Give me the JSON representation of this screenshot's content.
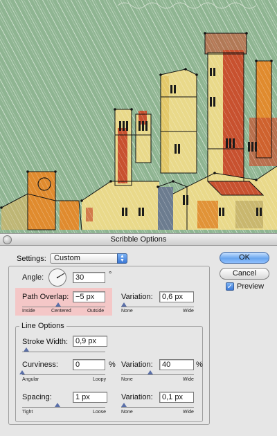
{
  "dialog": {
    "title": "Scribble Options",
    "settings_label": "Settings:",
    "settings_value": "Custom",
    "angle_label": "Angle:",
    "angle_value": "30",
    "angle_unit": "°",
    "path_overlap_label": "Path Overlap:",
    "path_overlap_value": "−5 px",
    "path_overlap_slider": {
      "min_label": "Inside",
      "mid_label": "Centered",
      "max_label": "Outside"
    },
    "path_overlap_variation_label": "Variation:",
    "path_overlap_variation_value": "0,6 px",
    "path_overlap_variation_slider": {
      "min_label": "None",
      "max_label": "Wide"
    },
    "line_options_title": "Line Options",
    "stroke_width_label": "Stroke Width:",
    "stroke_width_value": "0,9 px",
    "curviness_label": "Curviness:",
    "curviness_value": "0",
    "curviness_unit": "%",
    "curviness_slider": {
      "min_label": "Angular",
      "max_label": "Loopy"
    },
    "curviness_variation_label": "Variation:",
    "curviness_variation_value": "40",
    "curviness_variation_unit": "%",
    "curviness_variation_slider": {
      "min_label": "None",
      "max_label": "Wide"
    },
    "spacing_label": "Spacing:",
    "spacing_value": "1 px",
    "spacing_slider": {
      "min_label": "Tight",
      "max_label": "Loose"
    },
    "spacing_variation_label": "Variation:",
    "spacing_variation_value": "0,1 px",
    "spacing_variation_slider": {
      "min_label": "None",
      "max_label": "Wide"
    },
    "ok_label": "OK",
    "cancel_label": "Cancel",
    "preview_label": "Preview",
    "preview_checked": true
  },
  "colors": {
    "background_green": "#8fb592",
    "roof_red": "#c8512f",
    "wall_orange": "#e08b2e",
    "wall_yellow": "#e9d98a",
    "highlight_pink": "#f4c7c7",
    "accent_blue": "#3b78d6"
  }
}
